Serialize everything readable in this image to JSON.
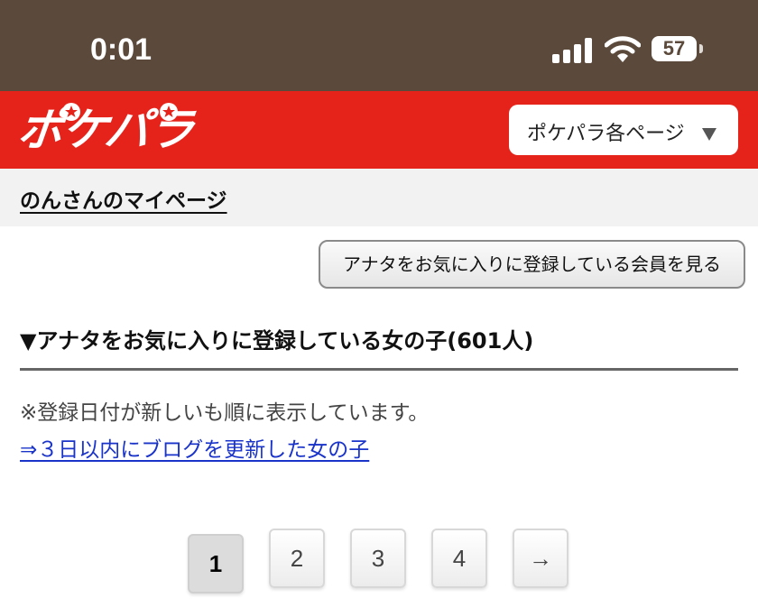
{
  "status_bar": {
    "time": "0:01",
    "battery": "57",
    "icons": [
      "signal-icon",
      "wifi-icon",
      "battery-icon"
    ]
  },
  "header": {
    "logo": "ポケパラ",
    "page_menu_label": "ポケパラ各ページ",
    "colors": {
      "brand_red": "#e6231b",
      "status_brown": "#5b4a3b"
    }
  },
  "mypage": {
    "link_text": "のんさんのマイページ"
  },
  "actions": {
    "view_members_label": "アナタをお気に入りに登録している会員を見る"
  },
  "section": {
    "heading": "▼アナタをお気に入りに登録している女の子(601人)",
    "note": "※登録日付が新しいも順に表示しています。",
    "blog_link": "⇒３日以内にブログを更新した女の子"
  },
  "pagination": {
    "pages": [
      "1",
      "2",
      "3",
      "4",
      "→"
    ],
    "current_page": 1
  }
}
